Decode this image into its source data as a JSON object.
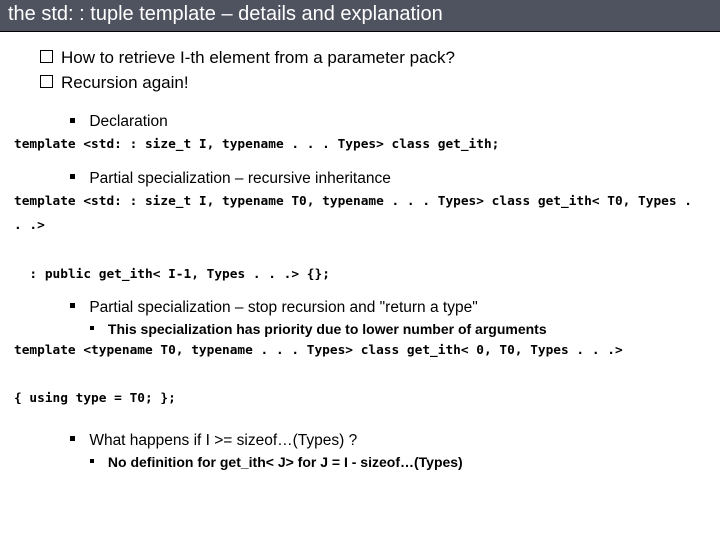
{
  "title": "the std: : tuple template – details and explanation",
  "intro": {
    "items": [
      "How to retrieve I-th element from a parameter pack?",
      "Recursion again!"
    ]
  },
  "sections": [
    {
      "label": "Declaration",
      "code": "template <std: : size_t I, typename . . . Types> class get_ith;"
    },
    {
      "label": "Partial specialization – recursive inheritance",
      "code": "template <std: : size_t I, typename T0, typename . . . Types> class get_ith< T0, Types . . .>\n\n  : public get_ith< I-1, Types . . .> {};"
    },
    {
      "label": "Partial specialization – stop recursion and \"return a type\"",
      "sub": "This specialization has priority due to lower number of arguments",
      "code": "template <typename T0, typename . . . Types> class get_ith< 0, T0, Types . . .>\n\n{ using type = T0; };"
    }
  ],
  "footer": {
    "question": "What happens if I >= sizeof…(Types) ?",
    "answer": "No definition for get_ith< J> for J = I - sizeof…(Types)"
  }
}
